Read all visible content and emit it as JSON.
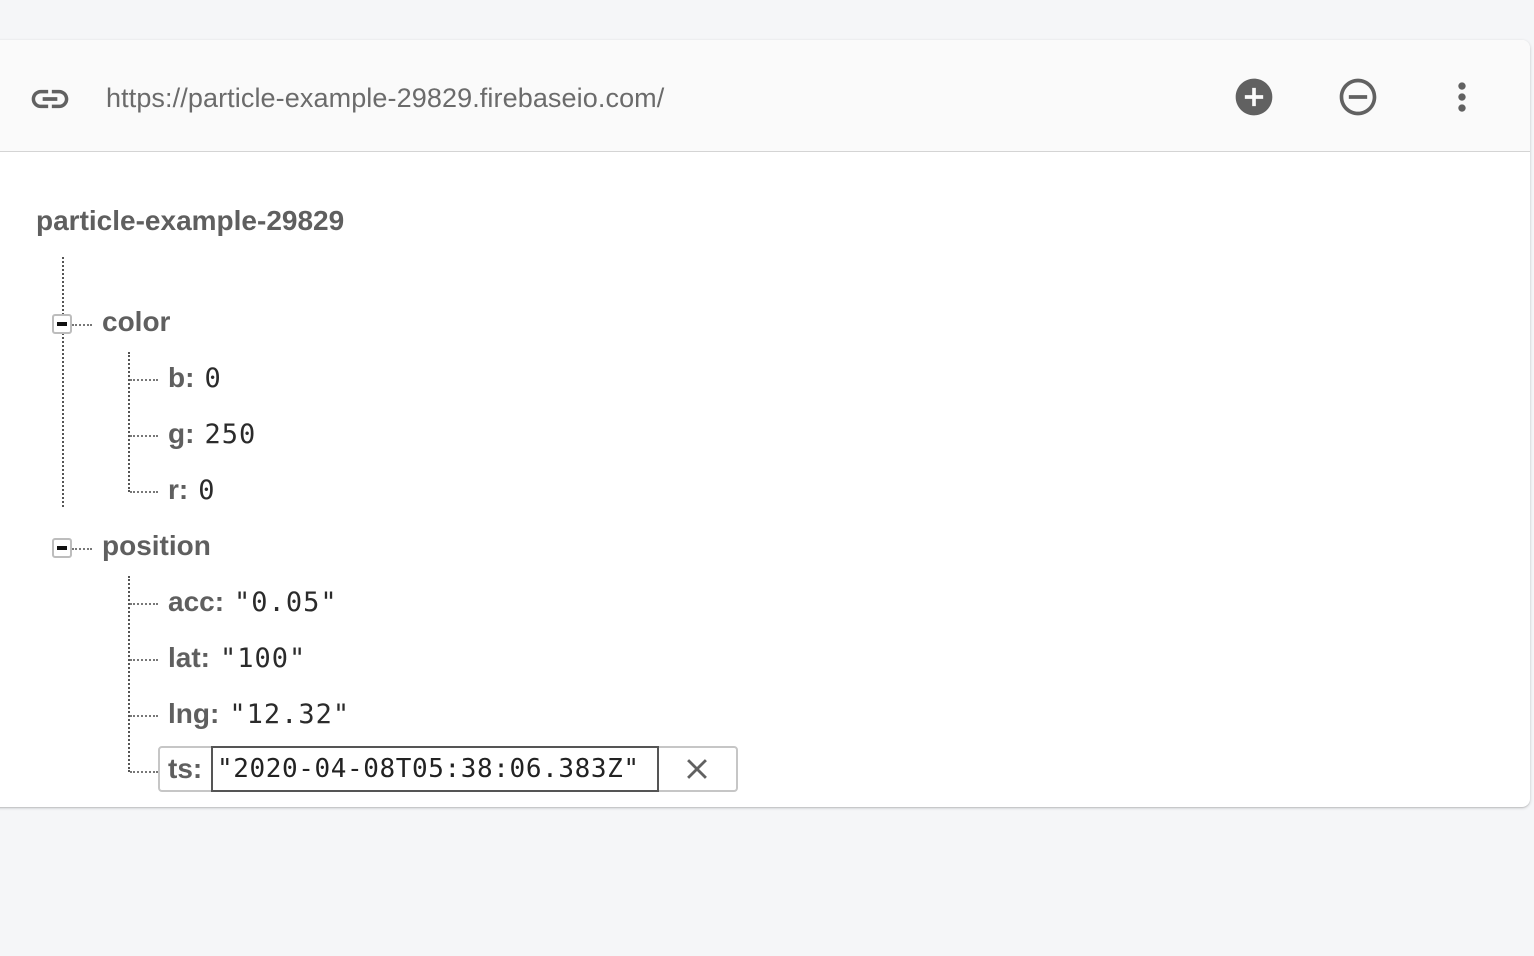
{
  "toolbar": {
    "url": "https://particle-example-29829.firebaseio.com/",
    "icons": {
      "link": "link-icon",
      "add": "add-circle-icon",
      "remove": "remove-circle-icon",
      "more": "more-vertical-icon"
    }
  },
  "tree": {
    "root": "particle-example-29829",
    "nodes": [
      {
        "key": "color",
        "expanded": true,
        "children": [
          {
            "key": "b:",
            "value": "0"
          },
          {
            "key": "g:",
            "value": "250"
          },
          {
            "key": "r:",
            "value": "0"
          }
        ]
      },
      {
        "key": "position",
        "expanded": true,
        "children": [
          {
            "key": "acc:",
            "value": "\"0.05\""
          },
          {
            "key": "lat:",
            "value": "\"100\""
          },
          {
            "key": "lng:",
            "value": "\"12.32\""
          },
          {
            "key": "ts:",
            "value": "\"2020-04-08T05:38:06.383Z\"",
            "editing": true
          }
        ]
      }
    ]
  },
  "colors": {
    "background": "#f5f6f8",
    "card": "#ffffff",
    "toolbar": "#fafafa",
    "text_key": "#5f5f5f",
    "text_url": "#6b6b6b",
    "icon": "#616161"
  }
}
